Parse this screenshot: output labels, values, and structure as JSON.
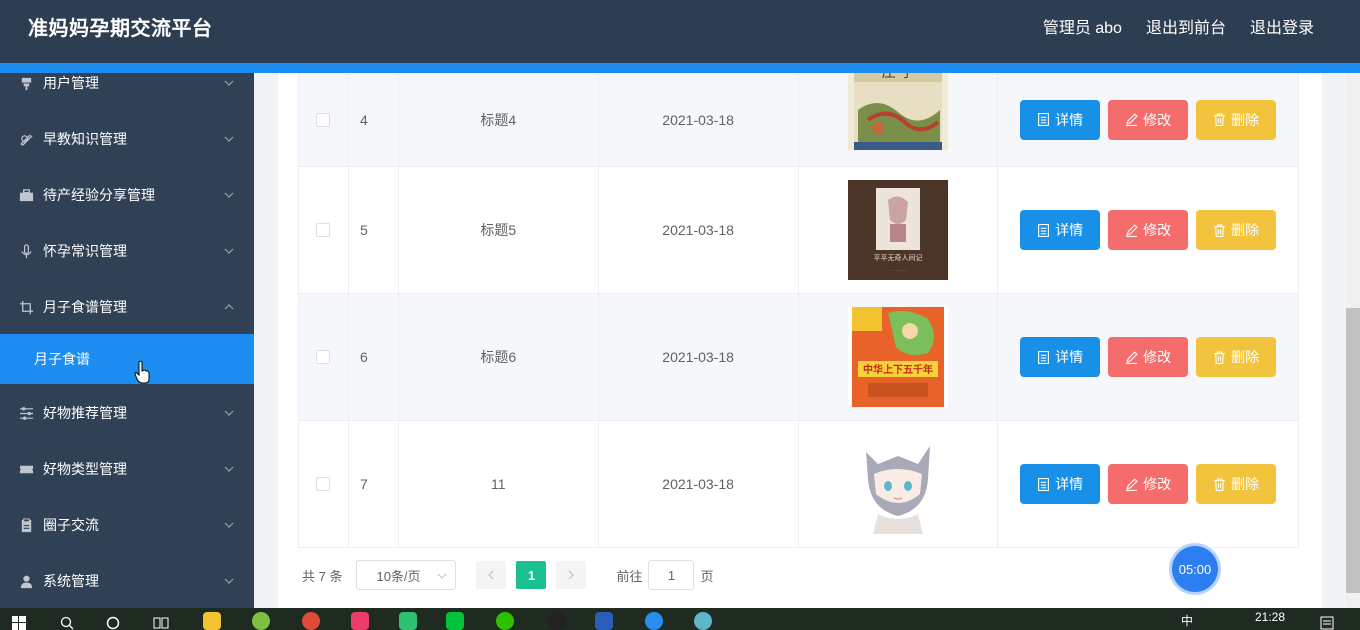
{
  "header": {
    "title": "准妈妈孕期交流平台",
    "admin_label": "管理员 abo",
    "to_front": "退出到前台",
    "logout": "退出登录"
  },
  "sidebar": {
    "items": [
      {
        "label": "用户管理",
        "icon": "user-icon"
      },
      {
        "label": "早教知识管理",
        "icon": "book-icon"
      },
      {
        "label": "待产经验分享管理",
        "icon": "briefcase-icon"
      },
      {
        "label": "怀孕常识管理",
        "icon": "microphone-icon"
      },
      {
        "label": "月子食谱管理",
        "icon": "crop-icon"
      },
      {
        "label": "好物推荐管理",
        "icon": "sliders-icon"
      },
      {
        "label": "好物类型管理",
        "icon": "ticket-icon"
      },
      {
        "label": "圈子交流",
        "icon": "clipboard-icon"
      },
      {
        "label": "系统管理",
        "icon": "user-icon"
      }
    ],
    "active_sub": "月子食谱"
  },
  "table": {
    "rows": [
      {
        "index": "4",
        "title": "标题4",
        "date": "2021-03-18",
        "image": "book-cover-zhuangzi"
      },
      {
        "index": "5",
        "title": "标题5",
        "date": "2021-03-18",
        "image": "book-cover-dark"
      },
      {
        "index": "6",
        "title": "标题6",
        "date": "2021-03-18",
        "image": "book-cover-orange"
      },
      {
        "index": "7",
        "title": "11",
        "date": "2021-03-18",
        "image": "anime-cat-boy"
      }
    ],
    "actions": {
      "detail": "详情",
      "edit": "修改",
      "delete": "删除"
    }
  },
  "pagination": {
    "total": "共 7 条",
    "page_size": "10条/页",
    "current_page": "1",
    "goto_label": "前往",
    "goto_value": "1",
    "page_suffix": "页"
  },
  "timer": "05:00",
  "taskbar": {
    "time": "21:28",
    "lang": "中"
  },
  "colors": {
    "header_bg": "#2e3e52",
    "accent_blue": "#1e8df2",
    "sidebar_bg": "#304156",
    "btn_detail": "#1890e8",
    "btn_edit": "#f56c6c",
    "btn_delete": "#f2c43d",
    "page_active": "#1cbf8f"
  }
}
